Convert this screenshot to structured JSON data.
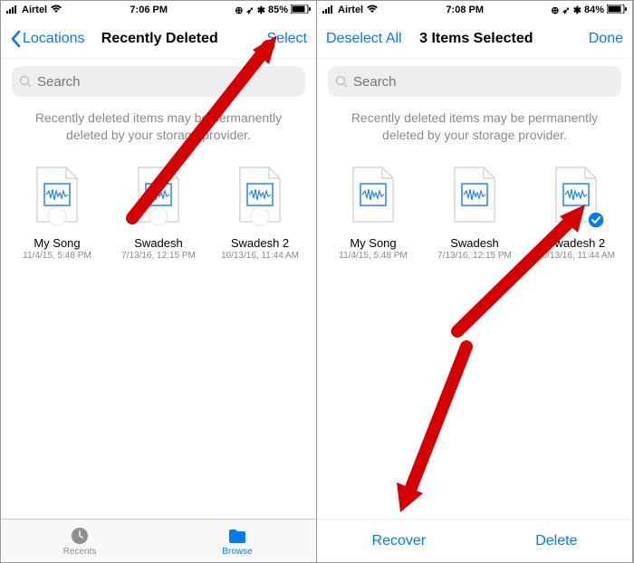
{
  "left": {
    "status": {
      "carrier": "Airtel",
      "time": "7:06 PM",
      "battery": "85%"
    },
    "nav": {
      "back": "Locations",
      "title": "Recently Deleted",
      "action": "Select"
    },
    "search": {
      "placeholder": "Search"
    },
    "info": "Recently deleted items may be permanently deleted by your storage provider.",
    "files": [
      {
        "name": "My Song",
        "date": "11/4/15, 5:48 PM"
      },
      {
        "name": "Swadesh",
        "date": "7/13/16, 12:15 PM"
      },
      {
        "name": "Swadesh 2",
        "date": "10/13/16, 11:44 AM"
      }
    ],
    "tabs": {
      "recents": "Recents",
      "browse": "Browse"
    }
  },
  "right": {
    "status": {
      "carrier": "Airtel",
      "time": "7:08 PM",
      "battery": "84%"
    },
    "nav": {
      "back": "Deselect All",
      "title": "3 Items Selected",
      "action": "Done"
    },
    "search": {
      "placeholder": "Search"
    },
    "info": "Recently deleted items may be permanently deleted by your storage provider.",
    "files": [
      {
        "name": "My Song",
        "date": "11/4/15, 5:48 PM"
      },
      {
        "name": "Swadesh",
        "date": "7/13/16, 12:15 PM"
      },
      {
        "name": "Swadesh 2",
        "date": "10/13/16, 11:44 AM"
      }
    ],
    "actions": {
      "recover": "Recover",
      "delete": "Delete"
    }
  }
}
